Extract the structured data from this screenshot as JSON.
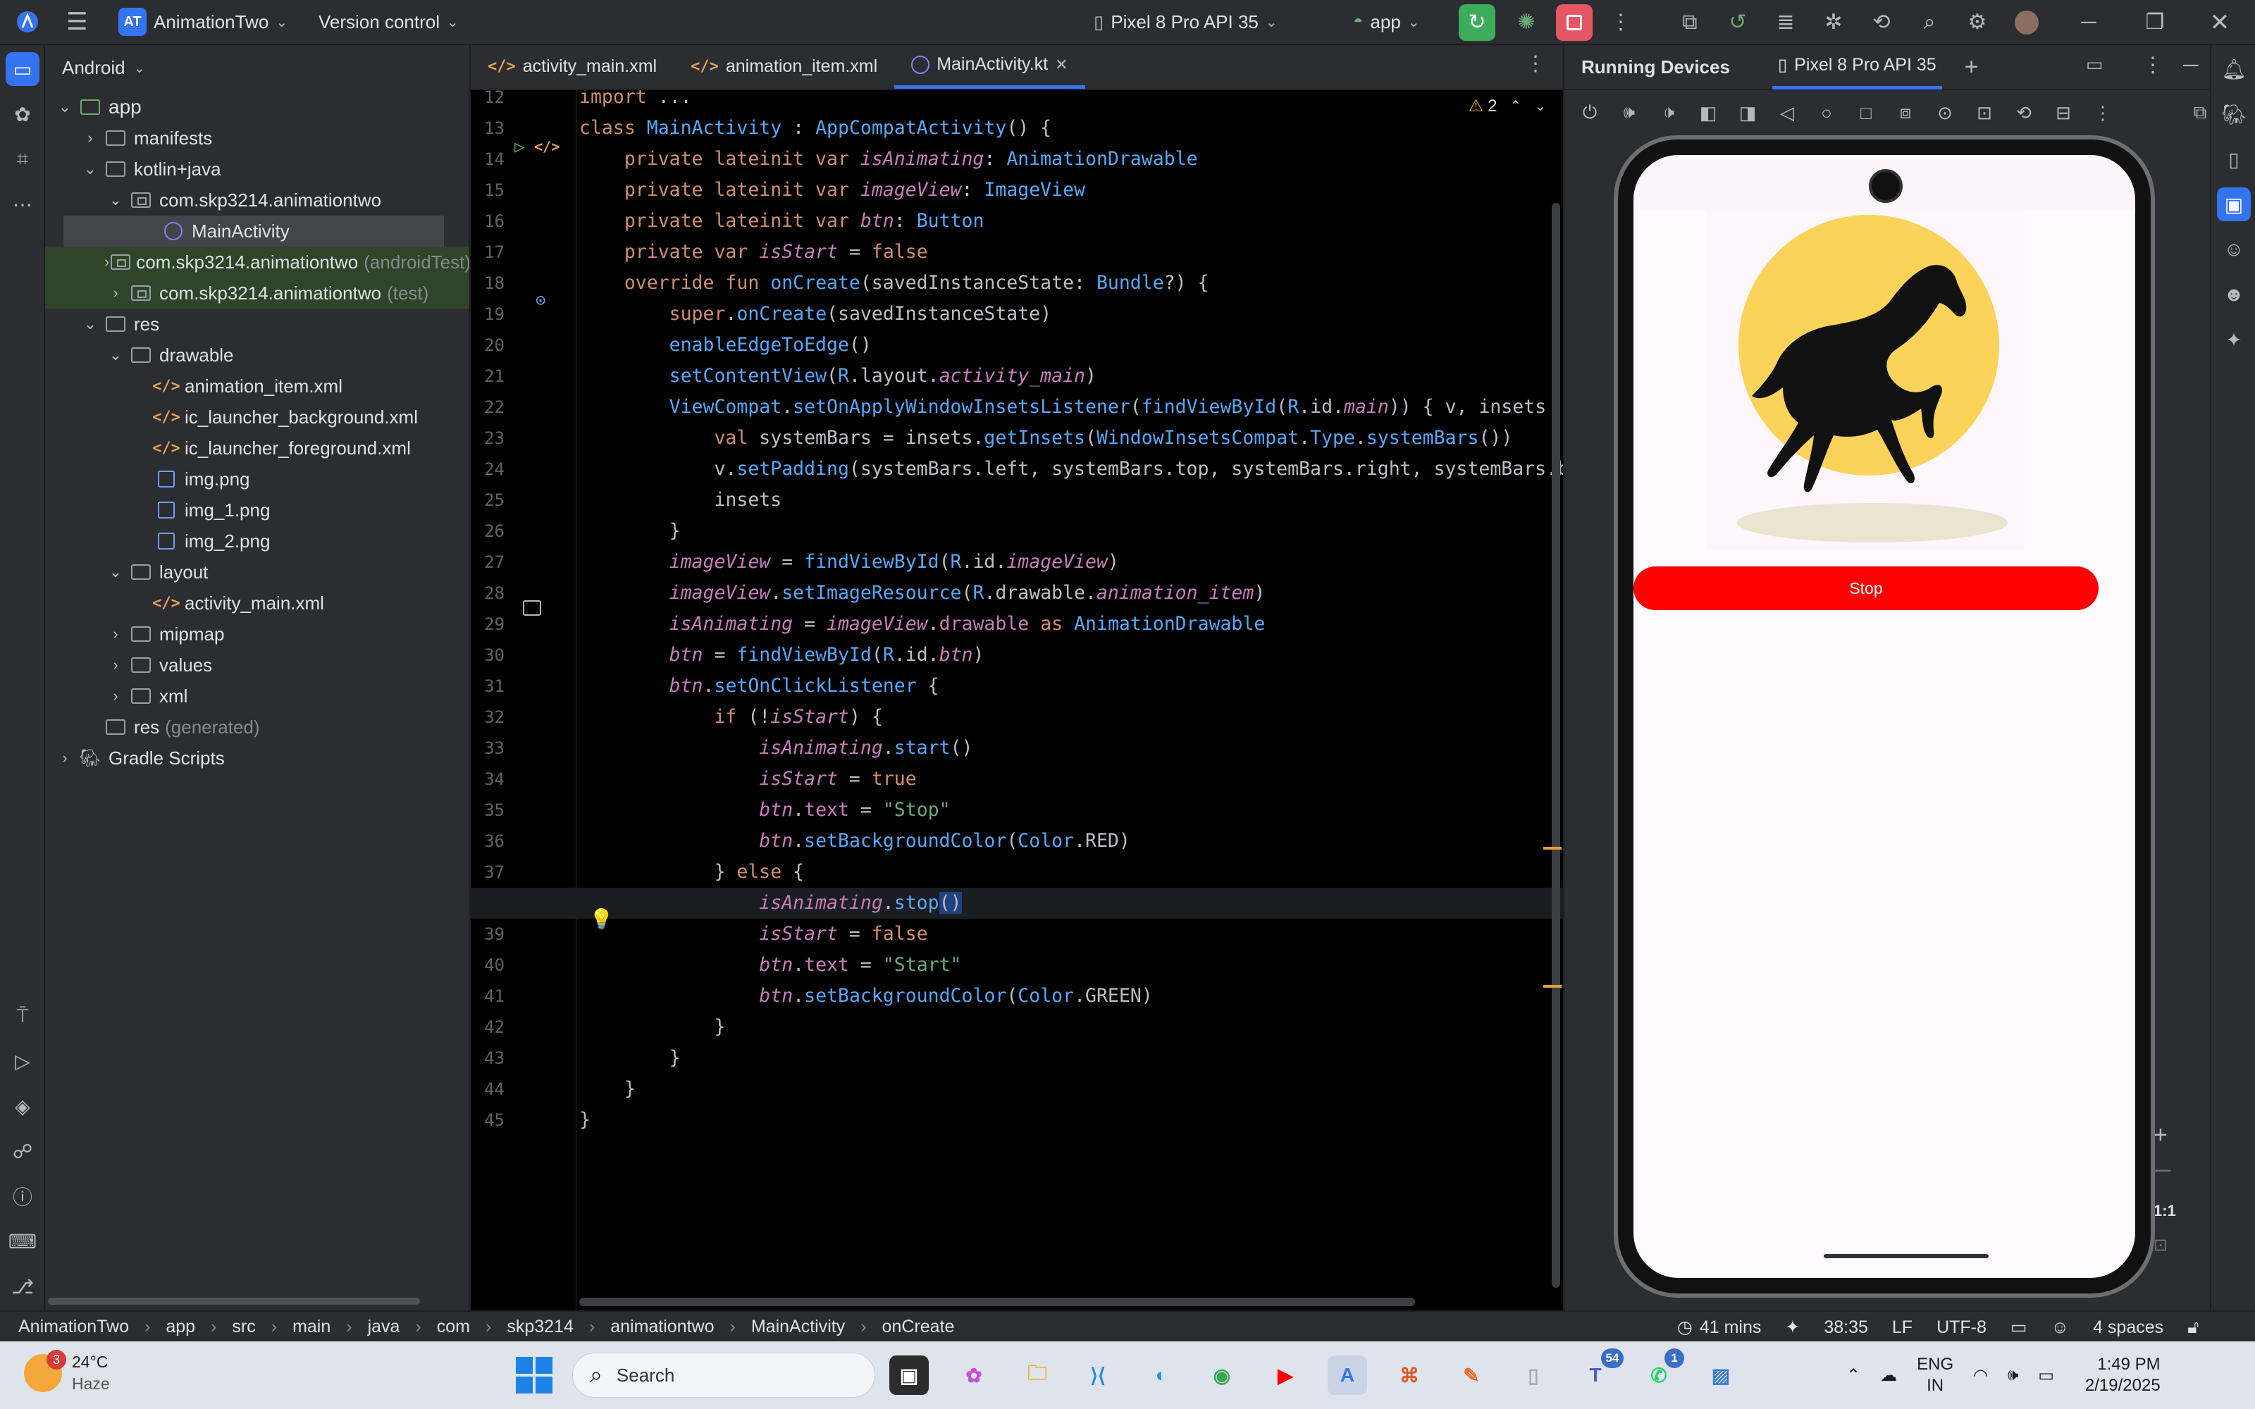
{
  "titlebar": {
    "project_badge": "AT",
    "project_name": "AnimationTwo",
    "vcs": "Version control",
    "device": "Pixel 8 Pro API 35",
    "run_config": "app"
  },
  "project_panel": {
    "view": "Android",
    "tree": [
      {
        "label": "app",
        "suffix": "",
        "type": "module",
        "depth": 0,
        "arrow": "down"
      },
      {
        "label": "manifests",
        "suffix": "",
        "type": "folder",
        "depth": 1,
        "arrow": "right"
      },
      {
        "label": "kotlin+java",
        "suffix": "",
        "type": "folder",
        "depth": 1,
        "arrow": "down"
      },
      {
        "label": "com.skp3214.animationtwo",
        "suffix": "",
        "type": "package",
        "depth": 2,
        "arrow": "down"
      },
      {
        "label": "MainActivity",
        "suffix": "",
        "type": "kotlin",
        "depth": 3,
        "arrow": ""
      },
      {
        "label": "com.skp3214.animationtwo",
        "suffix": "(androidTest)",
        "type": "package",
        "depth": 2,
        "arrow": "right"
      },
      {
        "label": "com.skp3214.animationtwo",
        "suffix": "(test)",
        "type": "package",
        "depth": 2,
        "arrow": "right"
      },
      {
        "label": "res",
        "suffix": "",
        "type": "folder",
        "depth": 1,
        "arrow": "down"
      },
      {
        "label": "drawable",
        "suffix": "",
        "type": "folder",
        "depth": 2,
        "arrow": "down"
      },
      {
        "label": "animation_item.xml",
        "suffix": "",
        "type": "xml",
        "depth": 3,
        "arrow": ""
      },
      {
        "label": "ic_launcher_background.xml",
        "suffix": "",
        "type": "xml",
        "depth": 3,
        "arrow": ""
      },
      {
        "label": "ic_launcher_foreground.xml",
        "suffix": "",
        "type": "xml",
        "depth": 3,
        "arrow": ""
      },
      {
        "label": "img.png",
        "suffix": "",
        "type": "png",
        "depth": 3,
        "arrow": ""
      },
      {
        "label": "img_1.png",
        "suffix": "",
        "type": "png",
        "depth": 3,
        "arrow": ""
      },
      {
        "label": "img_2.png",
        "suffix": "",
        "type": "png",
        "depth": 3,
        "arrow": ""
      },
      {
        "label": "layout",
        "suffix": "",
        "type": "folder",
        "depth": 2,
        "arrow": "down"
      },
      {
        "label": "activity_main.xml",
        "suffix": "",
        "type": "xml",
        "depth": 3,
        "arrow": ""
      },
      {
        "label": "mipmap",
        "suffix": "",
        "type": "folder",
        "depth": 2,
        "arrow": "right"
      },
      {
        "label": "values",
        "suffix": "",
        "type": "folder",
        "depth": 2,
        "arrow": "right"
      },
      {
        "label": "xml",
        "suffix": "",
        "type": "folder",
        "depth": 2,
        "arrow": "right"
      },
      {
        "label": "res",
        "suffix": "(generated)",
        "type": "folder",
        "depth": 1,
        "arrow": ""
      },
      {
        "label": "Gradle Scripts",
        "suffix": "",
        "type": "gradle",
        "depth": 0,
        "arrow": "right"
      }
    ]
  },
  "editor": {
    "tabs": [
      "activity_main.xml",
      "animation_item.xml",
      "MainActivity.kt"
    ],
    "warnings": "2",
    "lines": [
      {
        "n": "12",
        "html": "<span class=\"kw\">import</span> ..."
      },
      {
        "n": "13",
        "html": "<span class=\"kw\">class</span> <span class=\"ty\">MainActivity</span> : <span class=\"ty\">AppCompatActivity</span>() {"
      },
      {
        "n": "14",
        "html": "    <span class=\"kw\">private lateinit var</span> <span class=\"it\">isAnimating</span>: <span class=\"ty\">AnimationDrawable</span>"
      },
      {
        "n": "15",
        "html": "    <span class=\"kw\">private lateinit var</span> <span class=\"it\">imageView</span>: <span class=\"ty\">ImageView</span>"
      },
      {
        "n": "16",
        "html": "    <span class=\"kw\">private lateinit var</span> <span class=\"it\">btn</span>: <span class=\"ty\">Button</span>"
      },
      {
        "n": "17",
        "html": "    <span class=\"kw\">private var</span> <span class=\"it\">isStart</span> = <span class=\"kw\">false</span>"
      },
      {
        "n": "18",
        "html": "    <span class=\"kw\">override fun</span> <span class=\"fn\">onCreate</span>(savedInstanceState: <span class=\"ty\">Bundle</span>?) {"
      },
      {
        "n": "19",
        "html": "        <span class=\"kw\">super</span>.<span class=\"fn\">onCreate</span>(savedInstanceState)"
      },
      {
        "n": "20",
        "html": "        <span class=\"fn\">enableEdgeToEdge</span>()"
      },
      {
        "n": "21",
        "html": "        <span class=\"fn\">setContentView</span>(<span class=\"ty\">R</span>.layout.<span class=\"it\">activity_main</span>)"
      },
      {
        "n": "22",
        "html": "        <span class=\"ty\">ViewCompat</span>.<span class=\"fn\">setOnApplyWindowInsetsListener</span>(<span class=\"fn\">findViewById</span>(<span class=\"ty\">R</span>.id.<span class=\"it\">main</span>)) { v, insets"
      },
      {
        "n": "23",
        "html": "            <span class=\"kw\">val</span> systemBars = insets.<span class=\"fn\">getInsets</span>(<span class=\"ty\">WindowInsetsCompat</span>.<span class=\"ty\">Type</span>.<span class=\"fn\">systemBars</span>())"
      },
      {
        "n": "24",
        "html": "            v.<span class=\"fn\">setPadding</span>(systemBars.left, systemBars.top, systemBars.right, systemBars.b"
      },
      {
        "n": "25",
        "html": "            insets"
      },
      {
        "n": "26",
        "html": "        }"
      },
      {
        "n": "27",
        "html": "        <span class=\"it\">imageView</span> = <span class=\"fn\">findViewById</span>(<span class=\"ty\">R</span>.id.<span class=\"it\">imageView</span>)"
      },
      {
        "n": "28",
        "html": "        <span class=\"it\">imageView</span>.<span class=\"fn\">setImageResource</span>(<span class=\"ty\">R</span>.drawable.<span class=\"it\">animation_item</span>)"
      },
      {
        "n": "29",
        "html": "        <span class=\"it\">isAnimating</span> = <span class=\"it\">imageView</span>.<span class=\"prop\">drawable</span> <span class=\"kw\">as</span> <span class=\"ty\">AnimationDrawable</span>"
      },
      {
        "n": "30",
        "html": "        <span class=\"it\">btn</span> = <span class=\"fn\">findViewById</span>(<span class=\"ty\">R</span>.id.<span class=\"it\">btn</span>)"
      },
      {
        "n": "31",
        "html": "        <span class=\"it\">btn</span>.<span class=\"fn\">setOnClickListener</span> {"
      },
      {
        "n": "32",
        "html": "            <span class=\"kw\">if</span> (!<span class=\"it\">isStart</span>) {"
      },
      {
        "n": "33",
        "html": "                <span class=\"it\">isAnimating</span>.<span class=\"fn\">start</span>()"
      },
      {
        "n": "34",
        "html": "                <span class=\"it\">isStart</span> = <span class=\"kw\">true</span>"
      },
      {
        "n": "35",
        "html": "                <span class=\"it\">btn</span>.<span class=\"prop\">text</span> = <span class=\"str\">\"Stop\"</span>"
      },
      {
        "n": "36",
        "html": "                <span class=\"it\">btn</span>.<span class=\"fn\">setBackgroundColor</span>(<span class=\"ty\">Color</span>.RED)"
      },
      {
        "n": "37",
        "html": "            } <span class=\"kw\">else</span> {"
      },
      {
        "n": "38",
        "html": "                <span class=\"it\">isAnimating</span>.<span class=\"fn\">stop</span><span style=\"background:#214283\">()</span>"
      },
      {
        "n": "39",
        "html": "                <span class=\"it\">isStart</span> = <span class=\"kw\">false</span>"
      },
      {
        "n": "40",
        "html": "                <span class=\"it\">btn</span>.<span class=\"prop\">text</span> = <span class=\"str\">\"Start\"</span>"
      },
      {
        "n": "41",
        "html": "                <span class=\"it\">btn</span>.<span class=\"fn\">setBackgroundColor</span>(<span class=\"ty\">Color</span>.GREEN)"
      },
      {
        "n": "42",
        "html": "            }"
      },
      {
        "n": "43",
        "html": "        }"
      },
      {
        "n": "44",
        "html": "    }"
      },
      {
        "n": "45",
        "html": "}"
      }
    ]
  },
  "running_devices": {
    "title": "Running Devices",
    "device_tab": "Pixel 8 Pro API 35",
    "app_button_label": "Stop",
    "zoom_label": "1:1"
  },
  "statusbar": {
    "crumbs": [
      "AnimationTwo",
      "app",
      "src",
      "main",
      "java",
      "com",
      "skp3214",
      "animationtwo",
      "MainActivity",
      "onCreate"
    ],
    "time_spent": "41 mins",
    "position": "38:35",
    "line_sep": "LF",
    "encoding": "UTF-8",
    "indent": "4 spaces"
  },
  "taskbar": {
    "weather_badge": "3",
    "temperature": "24°C",
    "weather": "Haze",
    "search_placeholder": "Search",
    "teams_badge": "54",
    "whatsapp_badge": "1",
    "lang": "ENG",
    "region": "IN",
    "time": "1:49 PM",
    "date": "2/19/2025"
  },
  "colors": {
    "accent": "#3574f0",
    "run_green": "#3dad5c",
    "stop_red": "#e55765",
    "app_button": "#ff0000",
    "sun": "#fbd35a"
  }
}
